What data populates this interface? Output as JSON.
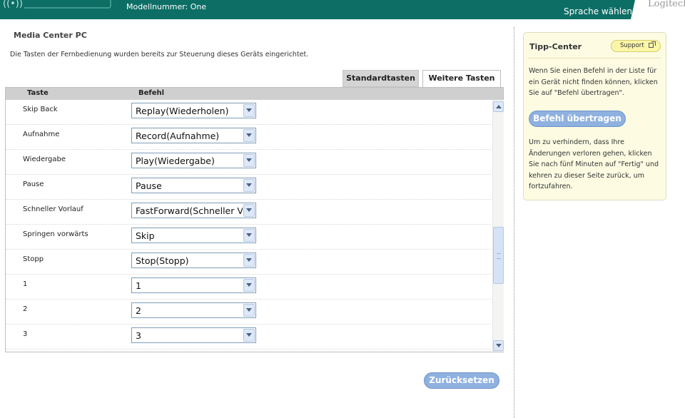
{
  "header": {
    "model_label": "Modellnummer: One",
    "language_link": "Sprache wählen",
    "brand": "Logitech"
  },
  "main": {
    "title": "Media Center PC",
    "intro": "Die Tasten der Fernbedienung wurden bereits zur Steuerung dieses Geräts eingerichtet.",
    "tabs": [
      {
        "label": "Standardtasten",
        "active": true
      },
      {
        "label": "Weitere Tasten",
        "active": false
      }
    ],
    "table": {
      "headers": {
        "key": "Taste",
        "command": "Befehl"
      },
      "rows": [
        {
          "key": "Skip Back",
          "command": "Replay(Wiederholen)"
        },
        {
          "key": "Aufnahme",
          "command": "Record(Aufnahme)"
        },
        {
          "key": "Wiedergabe",
          "command": "Play(Wiedergabe)"
        },
        {
          "key": "Pause",
          "command": "Pause"
        },
        {
          "key": "Schneller Vorlauf",
          "command": "FastForward(Schneller Vorlauf)"
        },
        {
          "key": "Springen vorwärts",
          "command": "Skip"
        },
        {
          "key": "Stopp",
          "command": "Stop(Stopp)"
        },
        {
          "key": "1",
          "command": "1"
        },
        {
          "key": "2",
          "command": "2"
        },
        {
          "key": "3",
          "command": "3"
        }
      ]
    },
    "reset_button": "Zurücksetzen"
  },
  "tips": {
    "title": "Tipp-Center",
    "support_button": "Support",
    "text1": "Wenn Sie einen Befehl in der Liste für ein Gerät nicht finden können, klicken Sie auf \"Befehl übertragen\".",
    "transfer_button": "Befehl übertragen",
    "text2": "Um zu verhindern, dass Ihre Änderungen verloren gehen, klicken Sie nach fünf Minuten auf \"Fertig\" und kehren zu dieser Seite zurück, um fortzufahren."
  },
  "colors": {
    "header_bg": "#0d6e66",
    "button_blue": "#8fb1e0",
    "tip_bg": "#fdfce3",
    "support_yellow": "#fbf6a7"
  },
  "icons": [
    "logo-arcs-icon",
    "external-link-icon",
    "chevron-down-icon",
    "scroll-up-icon",
    "scroll-down-icon"
  ]
}
